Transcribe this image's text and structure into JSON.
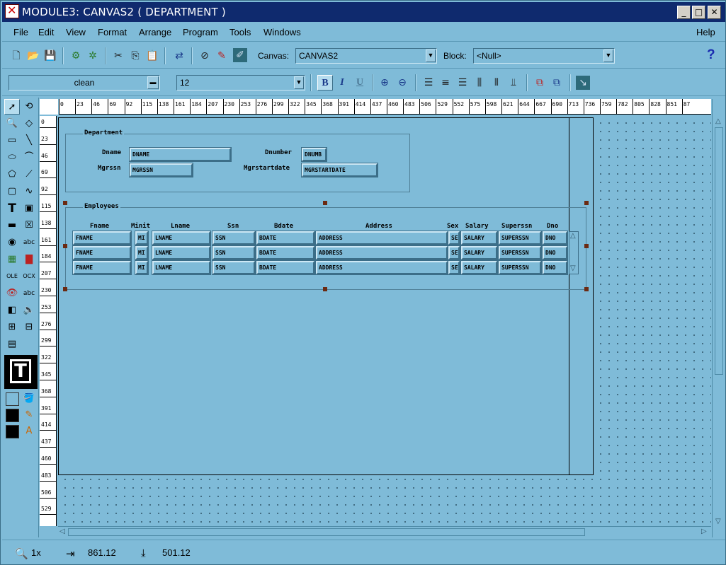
{
  "window": {
    "title": "MODULE3: CANVAS2 ( DEPARTMENT )",
    "minimize": "_",
    "maximize": "□",
    "close": "✕"
  },
  "menu": {
    "items": [
      "File",
      "Edit",
      "View",
      "Format",
      "Arrange",
      "Program",
      "Tools",
      "Windows"
    ],
    "help": "Help"
  },
  "toolbar": {
    "canvas_label": "Canvas:",
    "canvas_value": "CANVAS2",
    "block_label": "Block:",
    "block_value": "<Null>",
    "help_glyph": "?"
  },
  "format_bar": {
    "font_value": "clean",
    "size_value": "12",
    "bold": "B",
    "italic": "I",
    "underline": "U"
  },
  "ruler": {
    "h_ticks": [
      "0",
      "23",
      "46",
      "69",
      "92",
      "115",
      "138",
      "161",
      "184",
      "207",
      "230",
      "253",
      "276",
      "299",
      "322",
      "345",
      "368",
      "391",
      "414",
      "437",
      "460",
      "483",
      "506",
      "529",
      "552",
      "575",
      "598",
      "621",
      "644",
      "667",
      "690",
      "713",
      "736",
      "759",
      "782",
      "805",
      "828",
      "851",
      "87"
    ],
    "v_ticks": [
      "0",
      "23",
      "46",
      "69",
      "92",
      "115",
      "138",
      "161",
      "184",
      "207",
      "230",
      "253",
      "276",
      "299",
      "322",
      "345",
      "368",
      "391",
      "414",
      "437",
      "460",
      "483",
      "506",
      "529"
    ]
  },
  "department_frame": {
    "title": "Department",
    "dname_label": "Dname",
    "dname_value": "DNAME",
    "dnumber_label": "Dnumber",
    "dnumber_value": "DNUMB",
    "mgrssn_label": "Mgrssn",
    "mgrssn_value": "MGRSSN",
    "mgrstartdate_label": "Mgrstartdate",
    "mgrstartdate_value": "MGRSTARTDATE"
  },
  "employees_frame": {
    "title": "Employees",
    "columns": [
      "Fname",
      "Minit",
      "Lname",
      "Ssn",
      "Bdate",
      "Address",
      "Sex",
      "Salary",
      "Superssn",
      "Dno"
    ],
    "rows": [
      [
        "FNAME",
        "MI",
        "LNAME",
        "SSN",
        "BDATE",
        "ADDRESS",
        "SE",
        "SALARY",
        "SUPERSSN",
        "DNO"
      ],
      [
        "FNAME",
        "MI",
        "LNAME",
        "SSN",
        "BDATE",
        "ADDRESS",
        "SE",
        "SALARY",
        "SUPERSSN",
        "DNO"
      ],
      [
        "FNAME",
        "MI",
        "LNAME",
        "SSN",
        "BDATE",
        "ADDRESS",
        "SE",
        "SALARY",
        "SUPERSSN",
        "DNO"
      ]
    ]
  },
  "status": {
    "zoom": "1x",
    "x": "861.12",
    "y": "501.12"
  }
}
